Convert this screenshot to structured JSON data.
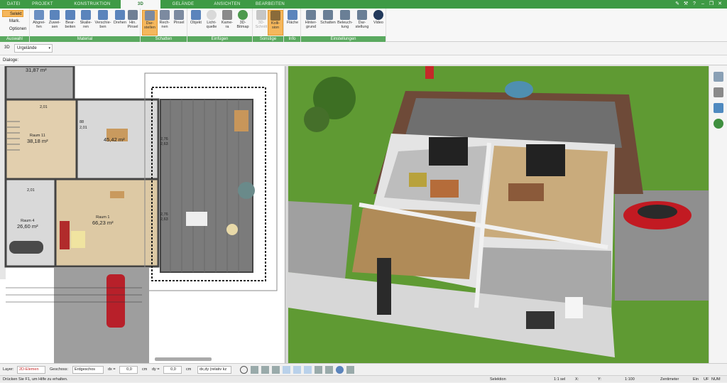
{
  "tabs": [
    "DATEI",
    "PROJEKT",
    "KONSTRUKTION",
    "3D",
    "GELÄNDE",
    "ANSICHTEN",
    "BEARBEITEN"
  ],
  "active_tab": "3D",
  "ribbon": {
    "auswahl": {
      "label": "Auswahl",
      "items": [
        "Selekt",
        "Mark.",
        "Optionen"
      ]
    },
    "material": {
      "label": "Material",
      "buttons": [
        "Abgrei-\nfen",
        "Zuwei-\nsen",
        "Bear-\nbeiten",
        "Skalie-\nren",
        "Verschie-\nben",
        "Drehen",
        "Hin.\nPinsel"
      ]
    },
    "schatten": {
      "label": "Schatten",
      "buttons": [
        "Dar-\nstellen",
        "Rech-\nnen",
        "Pinsel"
      ]
    },
    "einfuegen": {
      "label": "Einfügen",
      "buttons": [
        "Objekt",
        "Licht-\nquelle",
        "Kame-\nra",
        "3D-\nBitmap"
      ]
    },
    "sonstige": {
      "label": "Sonstige",
      "buttons": [
        "3D-\nSchnitt",
        "Kolli-\nsion"
      ]
    },
    "info": {
      "label": "Info",
      "buttons": [
        "Fläche"
      ]
    },
    "einstellungen": {
      "label": "Einstellungen",
      "buttons": [
        "Hinter-\ngrund",
        "Schatten",
        "Beleuch-\ntung",
        "Dar-\nstellung",
        "Video"
      ]
    }
  },
  "toolbar2": {
    "mode": "3D",
    "dropdown": "Urgelände"
  },
  "dialoge": "Dialoge:",
  "rooms": [
    {
      "name": "",
      "area": "31,87 m²"
    },
    {
      "name": "Raum 11",
      "area": "38,18 m²"
    },
    {
      "name": "",
      "area": "45,42 m²"
    },
    {
      "name": "Raum 4",
      "area": "26,60 m²"
    },
    {
      "name": "Raum 1",
      "area": "66,23 m²"
    }
  ],
  "dims": [
    "2,76",
    "2,63",
    "2,76",
    "2,63",
    "2,01",
    "2,01",
    "88",
    "2,01"
  ],
  "statusbar": {
    "layer_label": "Layer:",
    "layer_value": "2D-Elemen",
    "geschoss_label": "Geschoss:",
    "geschoss_value": "Erdgeschos",
    "dx_label": "dx =",
    "dx_value": "0,0",
    "dy_label": "dy =",
    "dy_value": "0,0",
    "unit": "cm",
    "mode": "dx,dy (relativ kz"
  },
  "status2": {
    "help": "Drücken Sie F1, um Hilfe zu erhalten.",
    "selektion": "Selektion",
    "scale1": "1:1 sel",
    "x": "X:",
    "y": "Y:",
    "scale2": "1:100",
    "unit": "Zentimeter",
    "ein": "Ein",
    "uf": "UF",
    "num": "NUM"
  },
  "colors": {
    "green": "#3e9a45",
    "accent": "#f5b75c",
    "grass": "#5e9a2f"
  }
}
